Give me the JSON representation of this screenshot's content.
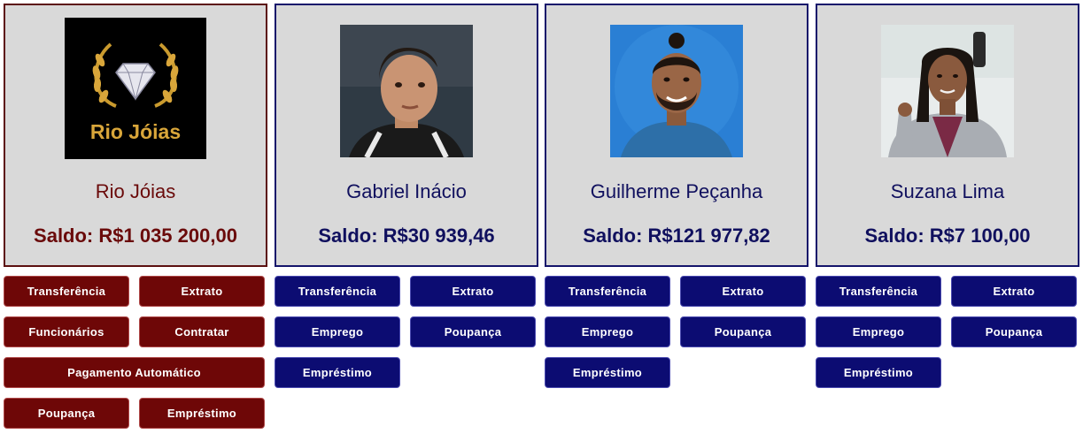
{
  "accounts": [
    {
      "type": "company",
      "avatar": "rio-joias-logo",
      "logo_text": "Rio Jóias",
      "name": "Rio Jóias",
      "balance": "Saldo: R$1 035 200,00",
      "buttons": [
        "Transferência",
        "Extrato",
        "Funcionários",
        "Contratar",
        "Pagamento Automático",
        "Poupança",
        "Empréstimo"
      ]
    },
    {
      "type": "person",
      "avatar": "photo-gabriel",
      "name": "Gabriel Inácio",
      "balance": "Saldo: R$30 939,46",
      "buttons": [
        "Transferência",
        "Extrato",
        "Emprego",
        "Poupança",
        "Empréstimo"
      ]
    },
    {
      "type": "person",
      "avatar": "photo-guilherme",
      "name": "Guilherme Peçanha",
      "balance": "Saldo: R$121 977,82",
      "buttons": [
        "Transferência",
        "Extrato",
        "Emprego",
        "Poupança",
        "Empréstimo"
      ]
    },
    {
      "type": "person",
      "avatar": "photo-suzana",
      "name": "Suzana Lima",
      "balance": "Saldo: R$7 100,00",
      "buttons": [
        "Transferência",
        "Extrato",
        "Emprego",
        "Poupança",
        "Empréstimo"
      ]
    }
  ],
  "colors": {
    "card_bg": "#d9d9d9",
    "person_text": "#10105e",
    "person_button": "#0c0c72",
    "company_text": "#6a0a0a",
    "company_button": "#6e0707"
  }
}
